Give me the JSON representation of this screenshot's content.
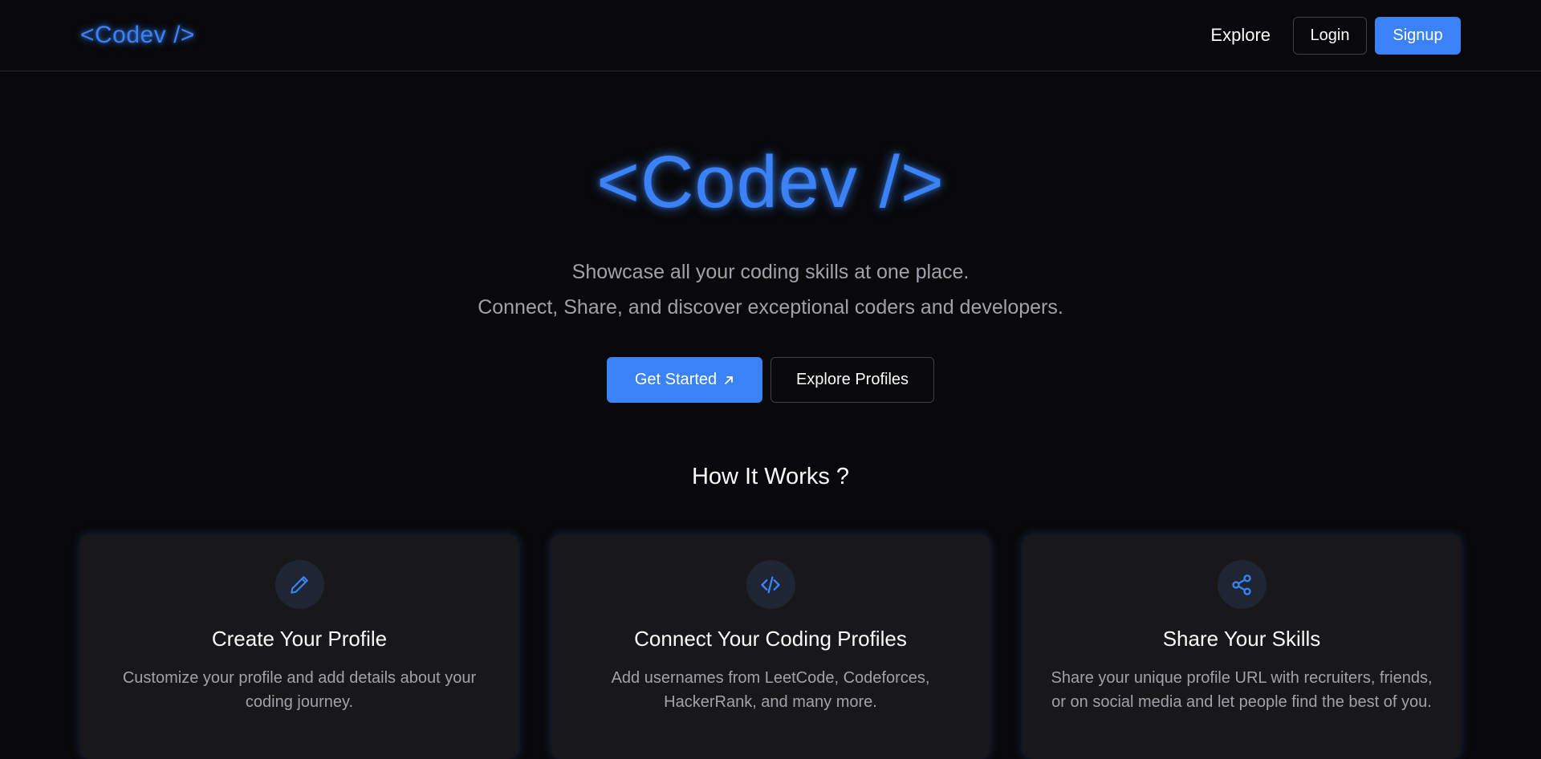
{
  "header": {
    "logo": "<Codev />",
    "nav": {
      "explore": "Explore",
      "login": "Login",
      "signup": "Signup"
    }
  },
  "hero": {
    "title": "<Codev />",
    "subtitle_line1": "Showcase all your coding skills at one place.",
    "subtitle_line2": "Connect, Share, and discover exceptional coders and developers.",
    "get_started": "Get Started",
    "explore_profiles": "Explore Profiles"
  },
  "how_it_works": {
    "title": "How It Works ?",
    "cards": [
      {
        "icon": "pencil-icon",
        "title": "Create Your Profile",
        "description": "Customize your profile and add details about your coding journey."
      },
      {
        "icon": "code-icon",
        "title": "Connect Your Coding Profiles",
        "description": "Add usernames from LeetCode, Codeforces, HackerRank, and many more."
      },
      {
        "icon": "share-icon",
        "title": "Share Your Skills",
        "description": "Share your unique profile URL with recruiters, friends, or on social media and let people find the best of you."
      }
    ]
  },
  "colors": {
    "background": "#09090b",
    "accent": "#3b82f6",
    "card": "#18181b",
    "muted_text": "#a1a1aa"
  }
}
